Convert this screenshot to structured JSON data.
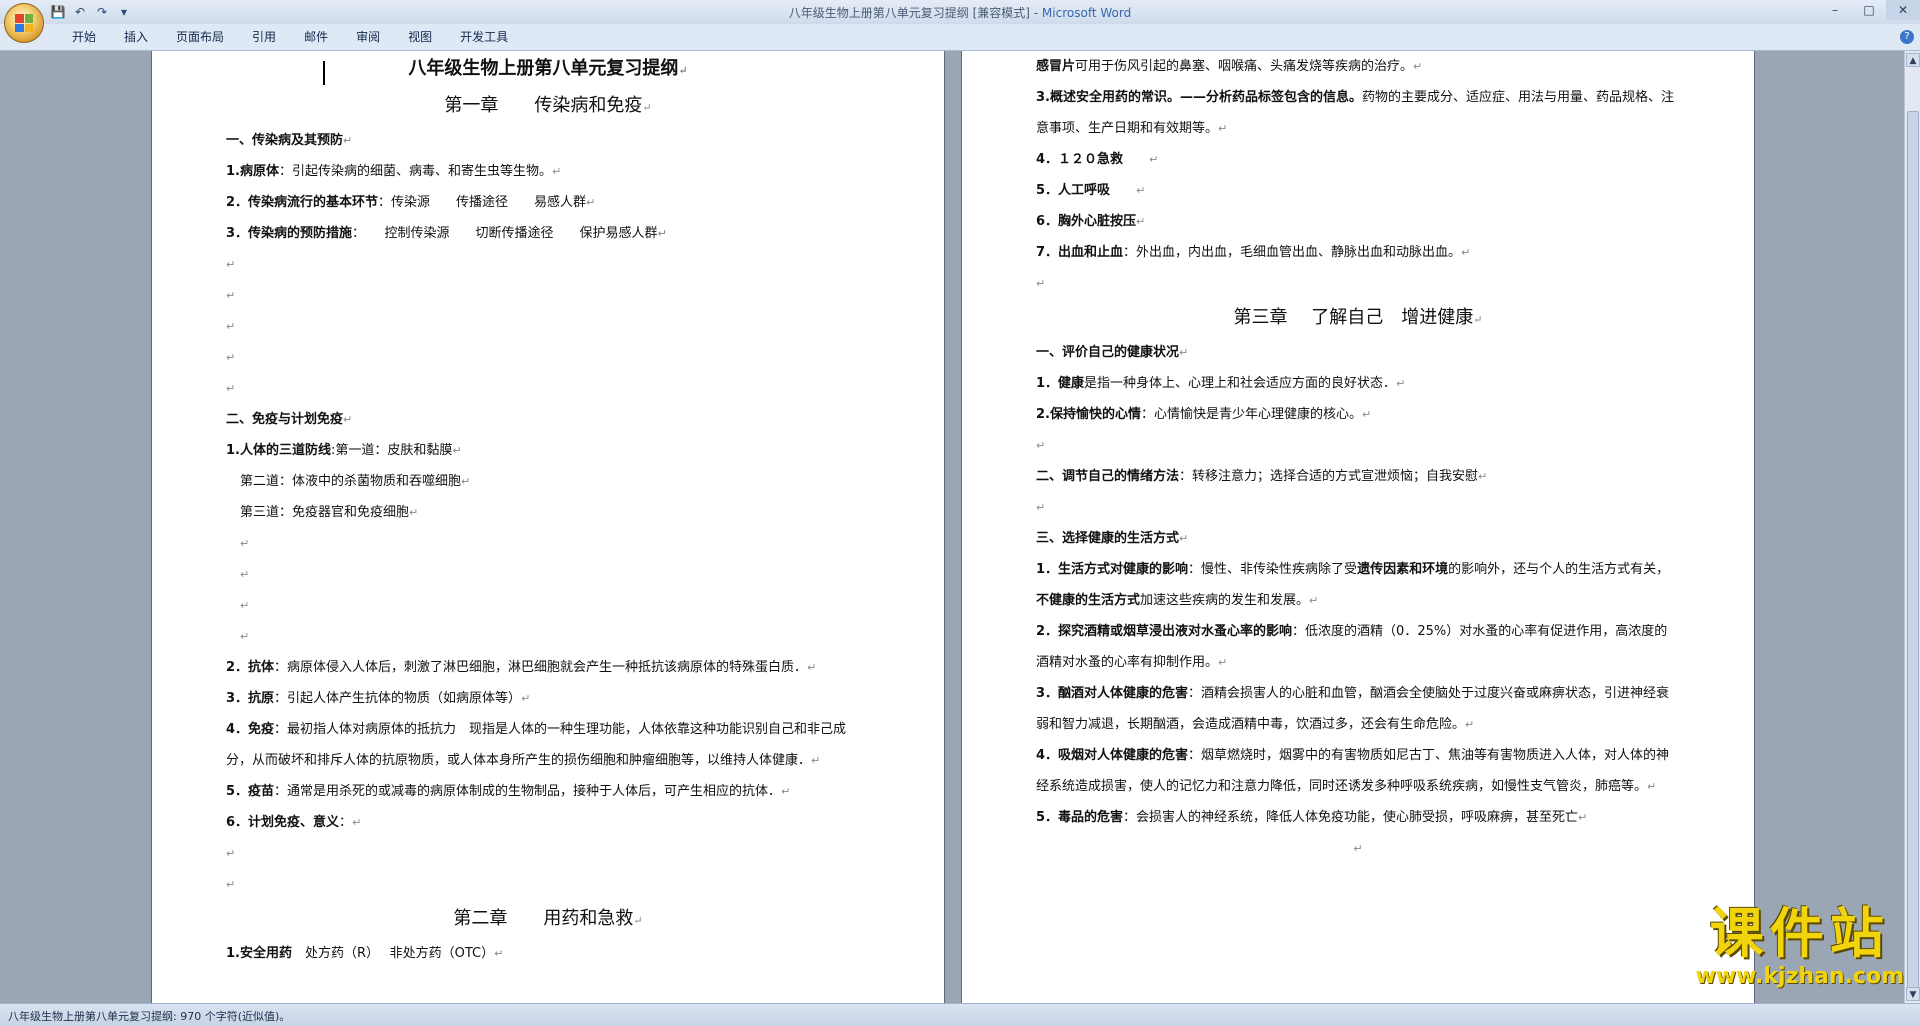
{
  "window": {
    "title_doc": "八年级生物上册第八单元复习提纲 [兼容模式] - ",
    "title_app": "Microsoft Word",
    "minimize": "–",
    "maximize": "□",
    "close": "✕"
  },
  "qat": {
    "save": "💾",
    "undo": "↶",
    "redo": "↷",
    "more": "▾"
  },
  "tabs": [
    "开始",
    "插入",
    "页面布局",
    "引用",
    "邮件",
    "审阅",
    "视图",
    "开发工具"
  ],
  "help": "?",
  "left_page": {
    "title": "八年级生物上册第八单元复习提纲",
    "chapter1": "第一章　　传染病和免疫",
    "s1": "一、传染病及其预防",
    "l1_b": "1.病原体",
    "l1_t": "：引起传染病的细菌、病毒、和寄生虫等生物。",
    "l2_b": "2．传染病流行的基本环节",
    "l2_t": "：传染源　　传播途径　　易感人群",
    "l3_b": "3．传染病的预防措施",
    "l3_t": "：　　控制传染源　　切断传播途径　　保护易感人群",
    "s2": "二、免疫与计划免疫",
    "i1_b": "1.人体的三道防线",
    "i1_t": ":第一道：皮肤和黏膜",
    "i1_2": "第二道：体液中的杀菌物质和吞噬细胞",
    "i1_3": "第三道：免疫器官和免疫细胞",
    "i2_b": "2．抗体",
    "i2_t": "：病原体侵入人体后，刺激了淋巴细胞，淋巴细胞就会产生一种抵抗该病原体的特殊蛋白质．",
    "i3_b": "3．抗原",
    "i3_t": "：引起人体产生抗体的物质（如病原体等）",
    "i4_b": "4．免疫",
    "i4_t": "：最初指人体对病原体的抵抗力　现指是人体的一种生理功能，人体依靠这种功能识别自己和非己成分，从而破坏和排斥人体的抗原物质，或人体本身所产生的损伤细胞和肿瘤细胞等，以维持人体健康．",
    "i5_b": "5．疫苗",
    "i5_t": "：通常是用杀死的或减毒的病原体制成的生物制品，接种于人体后，可产生相应的抗体．",
    "i6_b": "6．计划免疫、意义",
    "i6_t": "：",
    "chapter2": "第二章　　用药和急救",
    "d1_b": "1.安全用药",
    "d1_t": "　处方药（R）　 非处方药（OTC）"
  },
  "right_page": {
    "r0_b": "感冒片",
    "r0_t": "可用于伤风引起的鼻塞、咽喉痛、头痛发烧等疾病的治疗。",
    "r1_b": "3.概述安全用药的常识。——分析药品标签包含的信息。",
    "r1_t": "药物的主要成分、适应症、用法与用量、药品规格、注意事项、生产日期和有效期等。",
    "r2": "4．１２０急救",
    "r3": "5．人工呼吸",
    "r4": "6．胸外心脏按压",
    "r5_b": "7．出血和止血",
    "r5_t": "：外出血，内出血，毛细血管出血、静脉出血和动脉出血。",
    "chapter3": "第三章　 了解自己　增进健康",
    "s1": "一、评价自己的健康状况",
    "h1_b": "1．健康",
    "h1_t": "是指一种身体上、心理上和社会适应方面的良好状态．",
    "h2_b": "2.保持愉快的心情",
    "h2_t": "：心情愉快是青少年心理健康的核心。",
    "s2_b": "二、调节自己的情绪方法",
    "s2_t": "：转移注意力；选择合适的方式宣泄烦恼；自我安慰",
    "s3": "三、选择健康的生活方式",
    "lf1_b": "1．生活方式对健康的影响",
    "lf1_t1": "：慢性、非传染性疾病除了受",
    "lf1_b2": "遗传因素和环境",
    "lf1_t2": "的影响外，还与个人的生活方式有关，",
    "lf1_b3": "不健康的生活方式",
    "lf1_t3": "加速这些疾病的发生和发展。",
    "lf2_b": "2．探究酒精或烟草浸出液对水蚤心率的影响",
    "lf2_t": "：低浓度的酒精（0．25%）对水蚤的心率有促进作用，高浓度的酒精对水蚤的心率有抑制作用。",
    "lf3_b": "3．酗酒对人体健康的危害",
    "lf3_t": "：酒精会损害人的心脏和血管，酗酒会全使脑处于过度兴奋或麻痹状态，引进神经衰弱和智力减退，长期酗酒，会造成酒精中毒，饮酒过多，还会有生命危险。",
    "lf4_b": "4．吸烟对人体健康的危害",
    "lf4_t": "：烟草燃烧时，烟雾中的有害物质如尼古丁、焦油等有害物质进入人体，对人体的神经系统造成损害，使人的记忆力和注意力降低，同时还诱发多种呼吸系统疾病，如慢性支气管炎，肺癌等。",
    "lf5_b": "5．毒品的危害",
    "lf5_t": "：会损害人的神经系统，降低人体免疫功能，使心肺受损，呼吸麻痹，甚至死亡"
  },
  "para_mark": "↵",
  "status": "八年级生物上册第八单元复习提纲: 970 个字符(近似值)。",
  "watermark": {
    "main": "课件站",
    "url": "www.kjzhan.com"
  }
}
